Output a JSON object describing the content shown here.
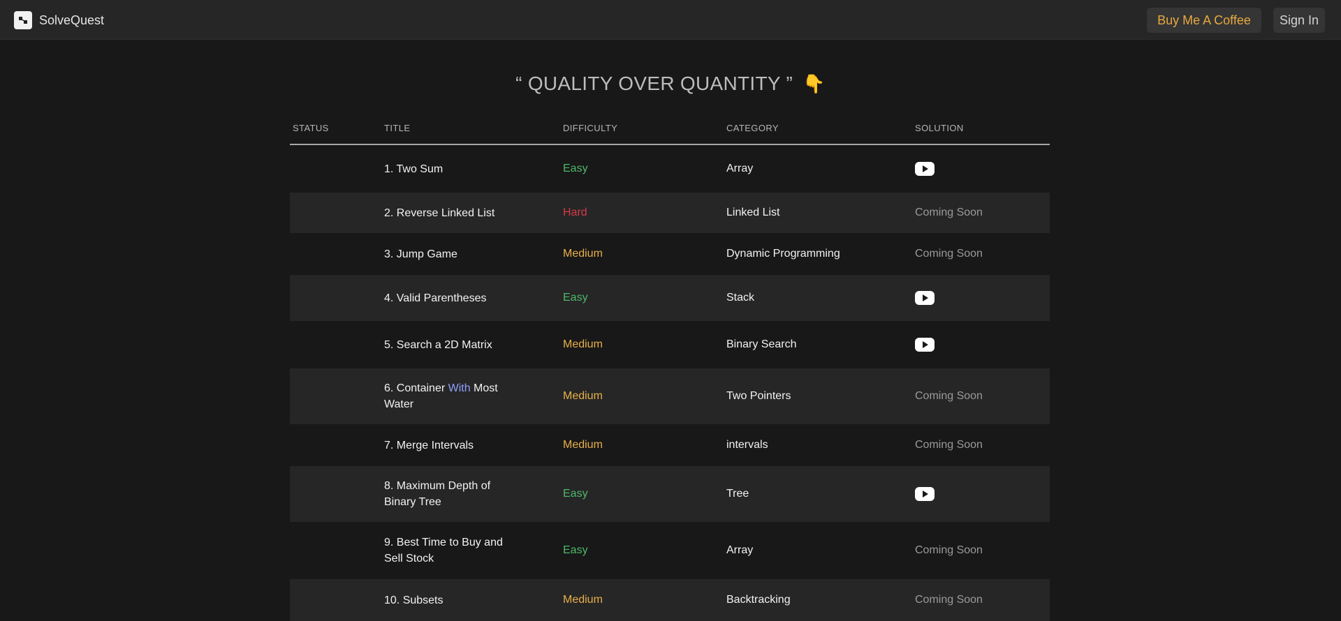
{
  "app": {
    "name": "SolveQuest",
    "logo_icon": "brand-logo-icon"
  },
  "header": {
    "coffee_label": "Buy Me A Coffee",
    "signin_label": "Sign In"
  },
  "heading": {
    "text": "“ QUALITY OVER QUANTITY ”",
    "emoji": "👇"
  },
  "colors": {
    "easy": "#4fb86a",
    "medium": "#e8b04a",
    "hard": "#d73a49",
    "accent": "#e8a93f"
  },
  "table": {
    "columns": [
      "STATUS",
      "TITLE",
      "DIFFICULTY",
      "CATEGORY",
      "SOLUTION"
    ],
    "rows": [
      {
        "status": "",
        "title": "1. Two Sum",
        "difficulty": "Easy",
        "level": "easy",
        "category": "Array",
        "solution": "video",
        "solution_icon": "youtube-icon"
      },
      {
        "status": "",
        "title": "2. Reverse Linked List",
        "difficulty": "Hard",
        "level": "hard",
        "category": "Linked List",
        "solution": "Coming Soon"
      },
      {
        "status": "",
        "title": "3. Jump Game",
        "difficulty": "Medium",
        "level": "medium",
        "category": "Dynamic Programming",
        "solution": "Coming Soon"
      },
      {
        "status": "",
        "title": "4. Valid Parentheses",
        "difficulty": "Easy",
        "level": "easy",
        "category": "Stack",
        "solution": "video",
        "solution_icon": "youtube-icon"
      },
      {
        "status": "",
        "title": "5. Search a 2D Matrix",
        "difficulty": "Medium",
        "level": "medium",
        "category": "Binary Search",
        "solution": "video",
        "solution_icon": "youtube-icon"
      },
      {
        "status": "",
        "title_parts": [
          "6. Container ",
          "With",
          " Most Water"
        ],
        "difficulty": "Medium",
        "level": "medium",
        "category": "Two Pointers",
        "solution": "Coming Soon"
      },
      {
        "status": "",
        "title": "7. Merge Intervals",
        "difficulty": "Medium",
        "level": "medium",
        "category": "intervals",
        "solution": "Coming Soon"
      },
      {
        "status": "",
        "title": "8. Maximum Depth of Binary Tree",
        "difficulty": "Easy",
        "level": "easy",
        "category": "Tree",
        "solution": "video",
        "solution_icon": "youtube-icon"
      },
      {
        "status": "",
        "title": "9. Best Time to Buy and Sell Stock",
        "difficulty": "Easy",
        "level": "easy",
        "category": "Array",
        "solution": "Coming Soon"
      },
      {
        "status": "",
        "title": "10. Subsets",
        "difficulty": "Medium",
        "level": "medium",
        "category": "Backtracking",
        "solution": "Coming Soon"
      }
    ]
  }
}
